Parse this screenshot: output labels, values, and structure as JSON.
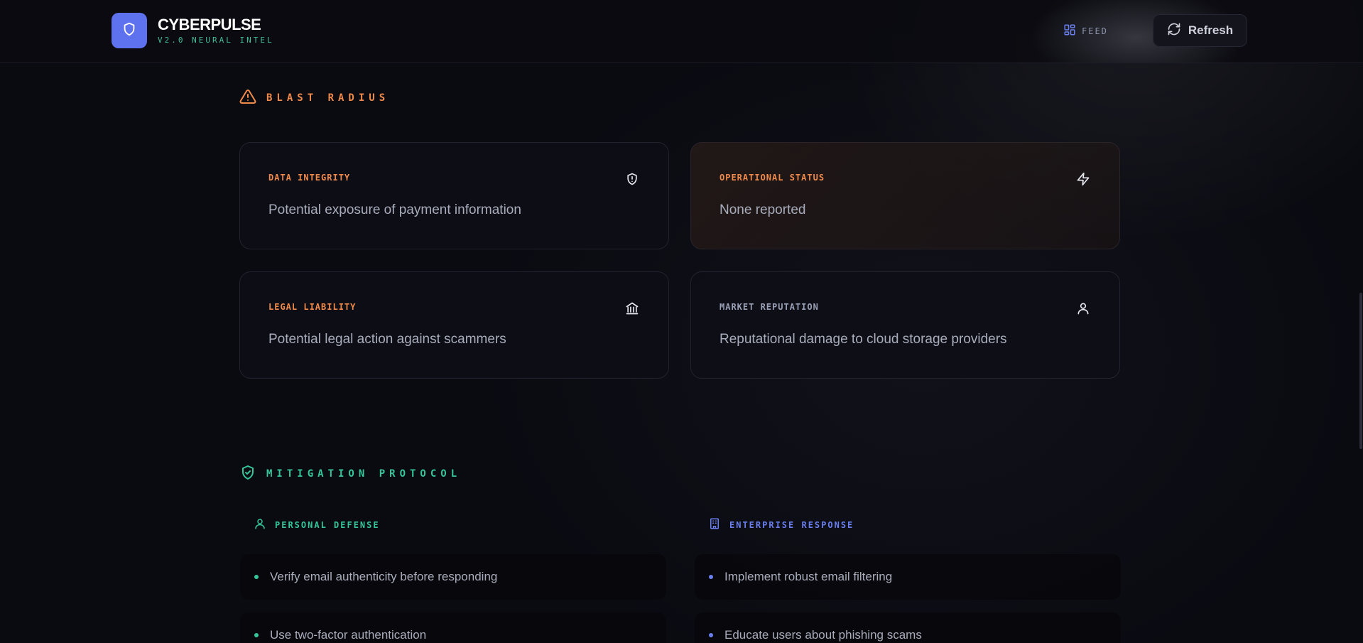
{
  "header": {
    "brand_title": "CYBERPULSE",
    "brand_subtitle": "V2.0 NEURAL INTEL",
    "feed_label": "FEED",
    "refresh_label": "Refresh"
  },
  "blast_radius": {
    "title": "BLAST RADIUS",
    "cards": [
      {
        "label": "DATA INTEGRITY",
        "text": "Potential exposure of payment information",
        "icon": "shield-alert-icon"
      },
      {
        "label": "OPERATIONAL STATUS",
        "text": "None reported",
        "icon": "lightning-icon"
      },
      {
        "label": "LEGAL LIABILITY",
        "text": "Potential legal action against scammers",
        "icon": "bank-icon"
      },
      {
        "label": "MARKET REPUTATION",
        "text": "Reputational damage to cloud storage providers",
        "icon": "user-icon"
      }
    ]
  },
  "mitigation": {
    "title": "MITIGATION PROTOCOL",
    "personal": {
      "title": "PERSONAL DEFENSE",
      "items": [
        "Verify email authenticity before responding",
        "Use two-factor authentication"
      ]
    },
    "enterprise": {
      "title": "ENTERPRISE RESPONSE",
      "items": [
        "Implement robust email filtering",
        "Educate users about phishing scams"
      ]
    }
  },
  "colors": {
    "accent_blue": "#5e72f0",
    "accent_orange": "#f08a4b",
    "accent_green": "#35c79a",
    "market_label": "#9aa0b5"
  }
}
